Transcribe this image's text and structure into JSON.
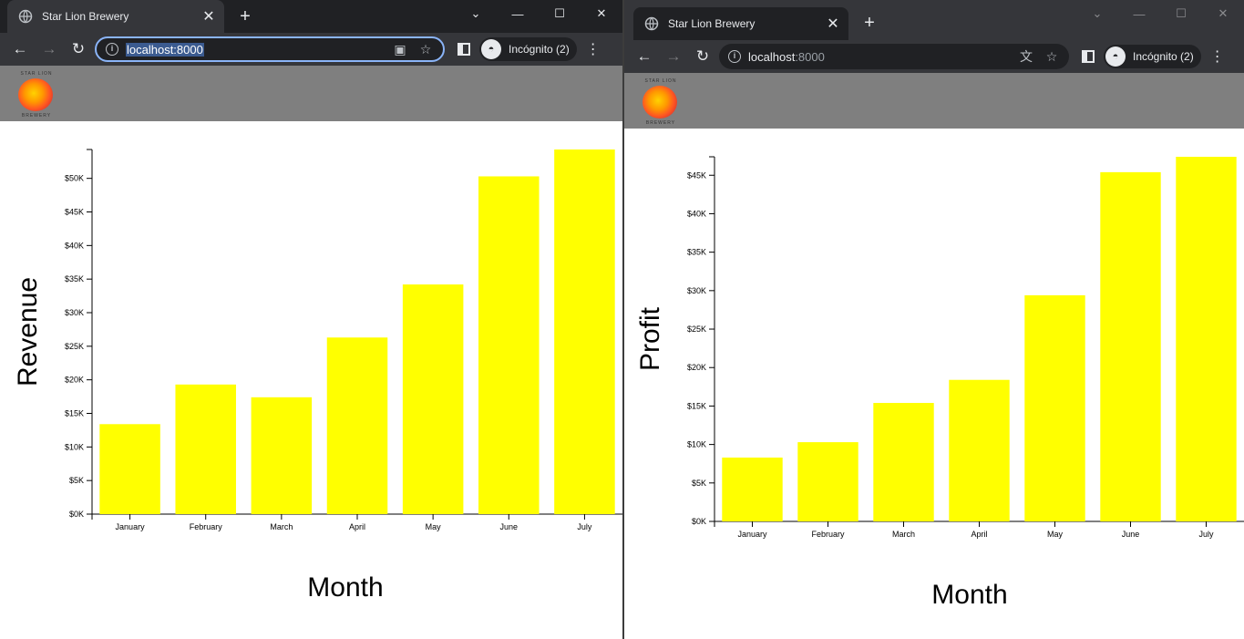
{
  "windows": [
    {
      "tab_title": "Star Lion Brewery",
      "url_host": "localhost:8000",
      "url_port": "",
      "url_selected": true,
      "profile_label": "Incógnito (2)",
      "logo_top": "STAR LION",
      "logo_bottom": "BREWERY",
      "chart_data": {
        "type": "bar",
        "categories": [
          "January",
          "February",
          "March",
          "April",
          "May",
          "June",
          "July"
        ],
        "values": [
          13400,
          19300,
          17400,
          26300,
          34200,
          50300,
          54300
        ],
        "xlabel": "Month",
        "ylabel": "Revenue",
        "ylim": [
          0,
          54300
        ],
        "yticks": [
          0,
          5000,
          10000,
          15000,
          20000,
          25000,
          30000,
          35000,
          40000,
          45000,
          50000
        ],
        "ytick_labels": [
          "$0K",
          "$5K",
          "$10K",
          "$15K",
          "$20K",
          "$25K",
          "$30K",
          "$35K",
          "$40K",
          "$45K",
          "$50K"
        ],
        "bar_color": "#ffff00"
      }
    },
    {
      "tab_title": "Star Lion Brewery",
      "url_host": "localhost",
      "url_port": ":8000",
      "url_selected": false,
      "profile_label": "Incógnito (2)",
      "logo_top": "STAR LION",
      "logo_bottom": "BREWERY",
      "chart_data": {
        "type": "bar",
        "categories": [
          "January",
          "February",
          "March",
          "April",
          "May",
          "June",
          "July"
        ],
        "values": [
          8300,
          10300,
          15400,
          18400,
          29400,
          45400,
          47400
        ],
        "xlabel": "Month",
        "ylabel": "Profit",
        "ylim": [
          0,
          47400
        ],
        "yticks": [
          0,
          5000,
          10000,
          15000,
          20000,
          25000,
          30000,
          35000,
          40000,
          45000
        ],
        "ytick_labels": [
          "$0K",
          "$5K",
          "$10K",
          "$15K",
          "$20K",
          "$25K",
          "$30K",
          "$35K",
          "$40K",
          "$45K"
        ],
        "bar_color": "#ffff00"
      }
    }
  ],
  "icons": {
    "favicon": "globe-icon",
    "back": "arrow-left-icon",
    "forward": "arrow-right-icon",
    "reload": "reload-icon",
    "info": "info-icon",
    "qr": "qr-code-icon",
    "translate": "translate-icon",
    "star": "star-icon",
    "side_panel": "side-panel-icon",
    "incognito": "incognito-icon",
    "menu": "kebab-menu-icon"
  }
}
